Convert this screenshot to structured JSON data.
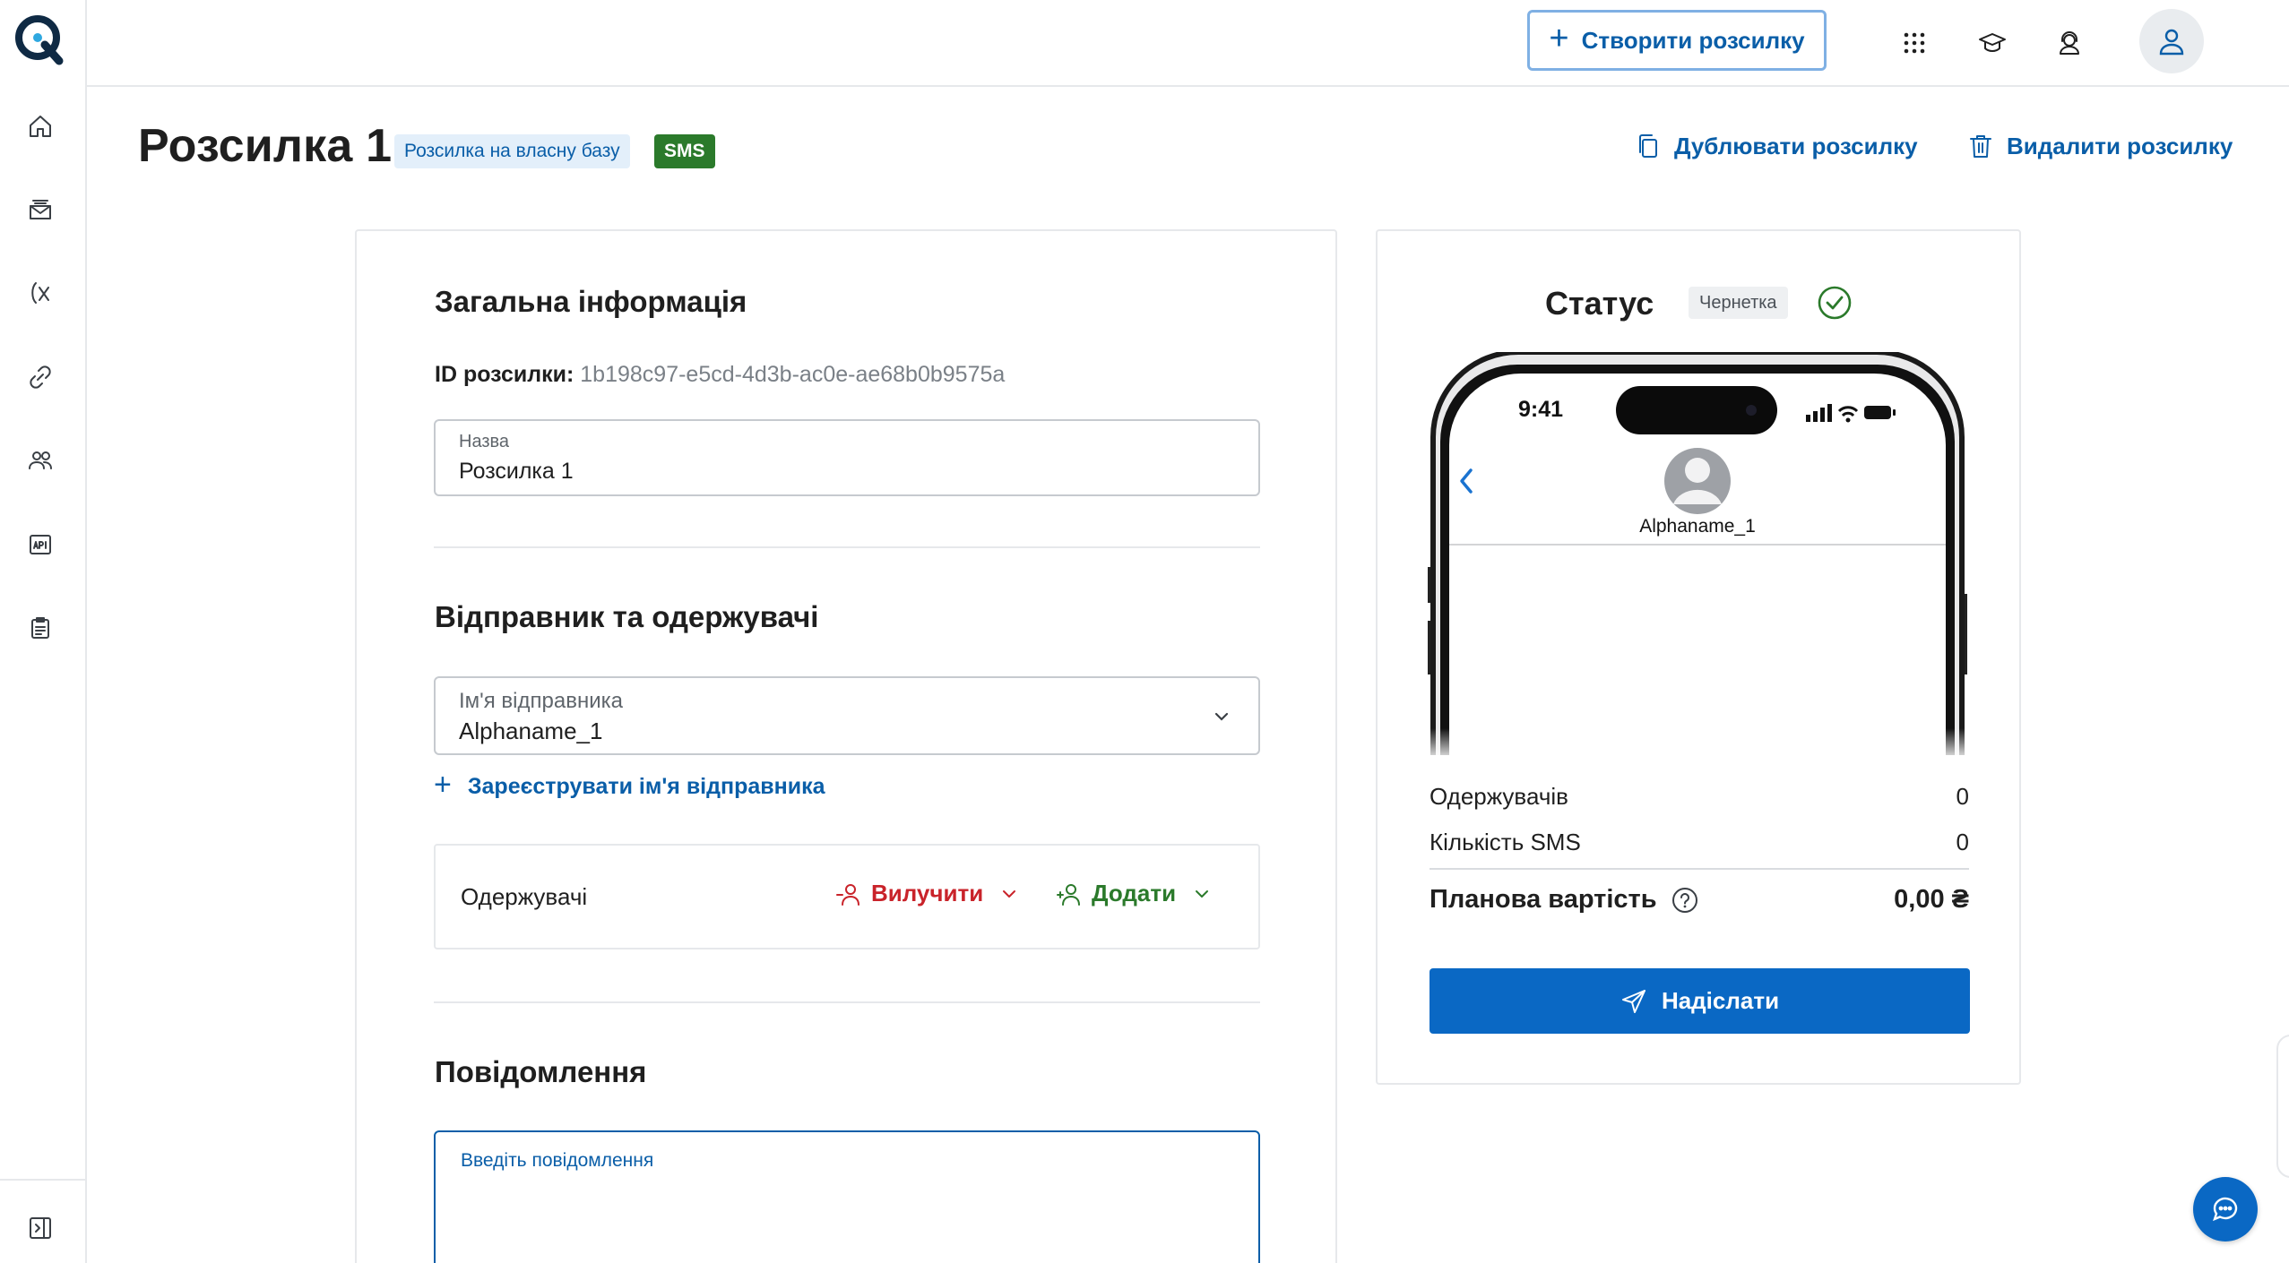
{
  "topbar": {
    "create_button": "Створити розсилку",
    "icons": [
      "apps-grid-icon",
      "graduation-cap-icon",
      "support-agent-icon",
      "user-icon",
      "chevron-down-icon"
    ]
  },
  "sidebar": {
    "items": [
      "home-icon",
      "mailbox-icon",
      "variable-icon",
      "link-icon",
      "users-icon",
      "api-icon",
      "clipboard-icon"
    ],
    "collapse_icon": "sidebar-collapse-icon"
  },
  "header": {
    "title": "Розсилка 1",
    "badge_own_base": "Розсилка на власну базу",
    "badge_channel": "SMS",
    "duplicate_label": "Дублювати розсилку",
    "delete_label": "Видалити розсилку"
  },
  "general": {
    "section_title": "Загальна інформація",
    "id_label": "ID розсилки:",
    "id_value": "1b198c97-e5cd-4d3b-ac0e-ae68b0b9575a",
    "name_label": "Назва",
    "name_value": "Розсилка 1"
  },
  "sender": {
    "section_title": "Відправник та одержувачі",
    "sender_label": "Ім'я відправника",
    "sender_value": "Alphaname_1",
    "register_link": "Зареєструвати ім'я відправника",
    "recipients_label": "Одержувачі",
    "exclude_label": "Вилучити",
    "add_label": "Додати"
  },
  "message": {
    "section_title": "Повідомлення",
    "placeholder": "Введіть повідомлення"
  },
  "status": {
    "title": "Статус",
    "badge": "Чернетка",
    "phone_time": "9:41",
    "phone_contact": "Alphaname_1",
    "recipients_label": "Одержувачів",
    "recipients_value": "0",
    "sms_count_label": "Кількість SMS",
    "sms_count_value": "0",
    "cost_label": "Планова вартість",
    "cost_value": "0,00 ₴",
    "send_button": "Надіслати"
  },
  "colors": {
    "accent": "#0a68c4",
    "link": "#0a5ea8",
    "sms_badge": "#2b7a2b",
    "exclude": "#c9232a",
    "add": "#2b7a2b"
  }
}
